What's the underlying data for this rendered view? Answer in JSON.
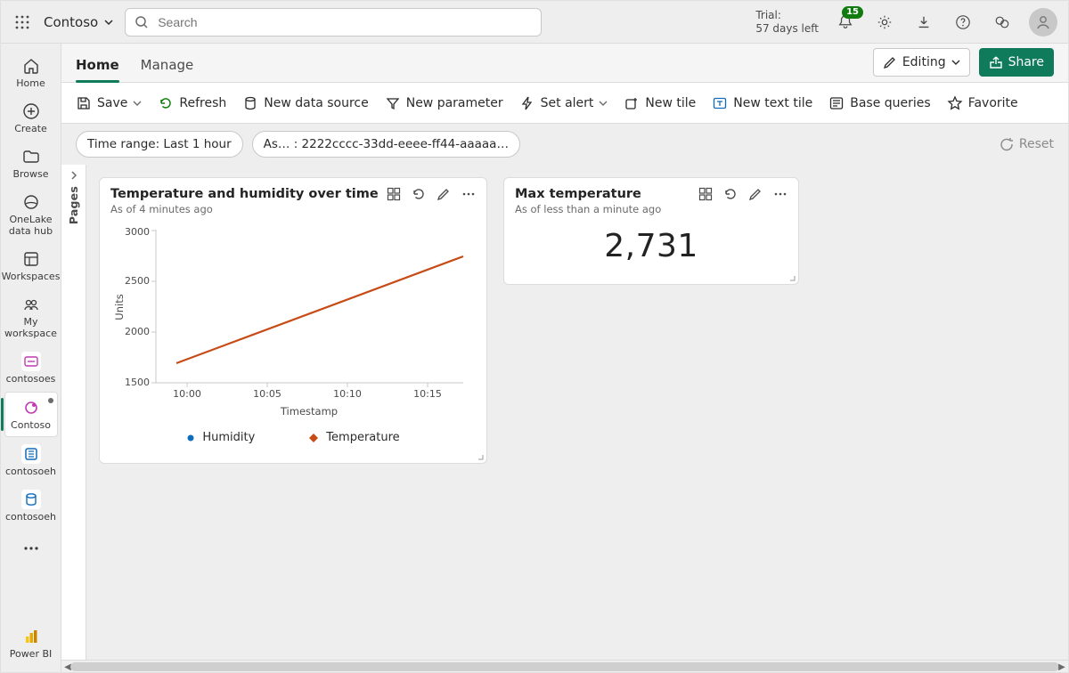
{
  "header": {
    "brand": "Contoso",
    "search_placeholder": "Search",
    "trial_line1": "Trial:",
    "trial_line2": "57 days left",
    "notification_count": "15"
  },
  "leftnav": {
    "items": [
      {
        "label": "Home"
      },
      {
        "label": "Create"
      },
      {
        "label": "Browse"
      },
      {
        "label": "OneLake data hub"
      },
      {
        "label": "Workspaces"
      },
      {
        "label": "My workspace"
      },
      {
        "label": "contosoes"
      },
      {
        "label": "Contoso"
      },
      {
        "label": "contosoeh"
      },
      {
        "label": "contosoeh"
      }
    ],
    "powerbi": "Power BI"
  },
  "tabs": {
    "items": [
      {
        "label": "Home",
        "active": true
      },
      {
        "label": "Manage",
        "active": false
      }
    ],
    "editing_label": "Editing",
    "share_label": "Share"
  },
  "toolbar": {
    "save": "Save",
    "refresh": "Refresh",
    "new_data_source": "New data source",
    "new_parameter": "New parameter",
    "set_alert": "Set alert",
    "new_tile": "New tile",
    "new_text_tile": "New text tile",
    "base_queries": "Base queries",
    "favorite": "Favorite"
  },
  "filters": {
    "time_range": "Time range: Last 1 hour",
    "asset": "As… : 2222cccc-33dd-eeee-ff44-aaaaa…",
    "reset": "Reset"
  },
  "pages_rail": "Pages",
  "cards": {
    "chart": {
      "title": "Temperature and humidity over time",
      "subtitle": "As of 4 minutes ago",
      "legend_humidity": "Humidity",
      "legend_temperature": "Temperature"
    },
    "stat": {
      "title": "Max temperature",
      "subtitle": "As of less than a minute ago",
      "value": "2,731"
    }
  },
  "chart_data": {
    "type": "line",
    "title": "Temperature and humidity over time",
    "xlabel": "Timestamp",
    "ylabel": "Units",
    "ylim": [
      1500,
      3000
    ],
    "yticks": [
      1500,
      2000,
      2500,
      3000
    ],
    "categories": [
      "10:00",
      "10:05",
      "10:10",
      "10:15"
    ],
    "series": [
      {
        "name": "Temperature",
        "color": "#c74b16",
        "values": [
          1700,
          2050,
          2400,
          2731
        ]
      },
      {
        "name": "Humidity",
        "color": "#0f6cbd",
        "values": [
          1700,
          2050,
          2400,
          2731
        ]
      }
    ]
  }
}
